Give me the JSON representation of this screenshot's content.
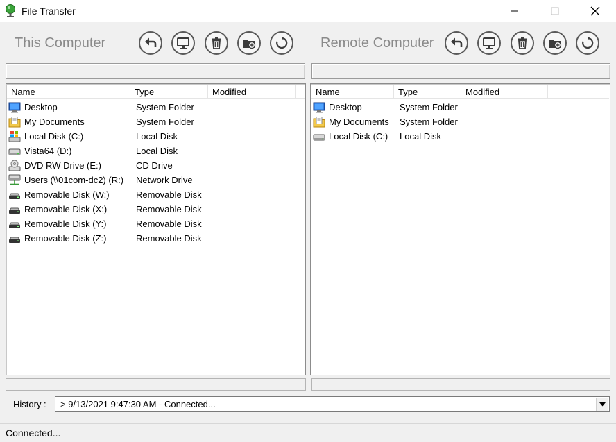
{
  "window": {
    "title": "File Transfer",
    "controls": [
      "minimize-icon",
      "maximize-icon",
      "close-icon"
    ]
  },
  "local": {
    "label": "This Computer",
    "path": "",
    "columns": [
      "Name",
      "Type",
      "Modified"
    ],
    "rows": [
      {
        "name": "Desktop",
        "type": "System Folder",
        "icon": "desktop-icon"
      },
      {
        "name": "My Documents",
        "type": "System Folder",
        "icon": "documents-folder-icon"
      },
      {
        "name": "Local Disk (C:)",
        "type": "Local Disk",
        "icon": "windows-disk-icon"
      },
      {
        "name": "Vista64 (D:)",
        "type": "Local Disk",
        "icon": "hard-disk-icon"
      },
      {
        "name": "DVD RW Drive (E:)",
        "type": "CD Drive",
        "icon": "dvd-drive-icon"
      },
      {
        "name": "Users (\\\\01com-dc2) (R:)",
        "type": "Network Drive",
        "icon": "network-drive-icon"
      },
      {
        "name": "Removable Disk (W:)",
        "type": "Removable Disk",
        "icon": "removable-disk-icon"
      },
      {
        "name": "Removable Disk (X:)",
        "type": "Removable Disk",
        "icon": "removable-disk-icon"
      },
      {
        "name": "Removable Disk (Y:)",
        "type": "Removable Disk",
        "icon": "removable-disk-icon"
      },
      {
        "name": "Removable Disk (Z:)",
        "type": "Removable Disk",
        "icon": "removable-disk-icon"
      }
    ]
  },
  "remote": {
    "label": "Remote Computer",
    "path": "",
    "columns": [
      "Name",
      "Type",
      "Modified"
    ],
    "rows": [
      {
        "name": "Desktop",
        "type": "System Folder",
        "icon": "desktop-icon"
      },
      {
        "name": "My Documents",
        "type": "System Folder",
        "icon": "documents-folder-icon"
      },
      {
        "name": "Local Disk (C:)",
        "type": "Local Disk",
        "icon": "hard-disk-icon"
      }
    ]
  },
  "toolbar_icons": [
    "back-arrow-icon",
    "computer-icon",
    "trash-icon",
    "new-folder-icon",
    "refresh-icon"
  ],
  "history": {
    "label": "History :",
    "value": "> 9/13/2021 9:47:30 AM  -  Connected..."
  },
  "status": {
    "text": "Connected..."
  },
  "colors": {
    "window_bg": "#f0f0f0",
    "list_bg": "#ffffff",
    "label_gray": "#8a8a8a"
  }
}
